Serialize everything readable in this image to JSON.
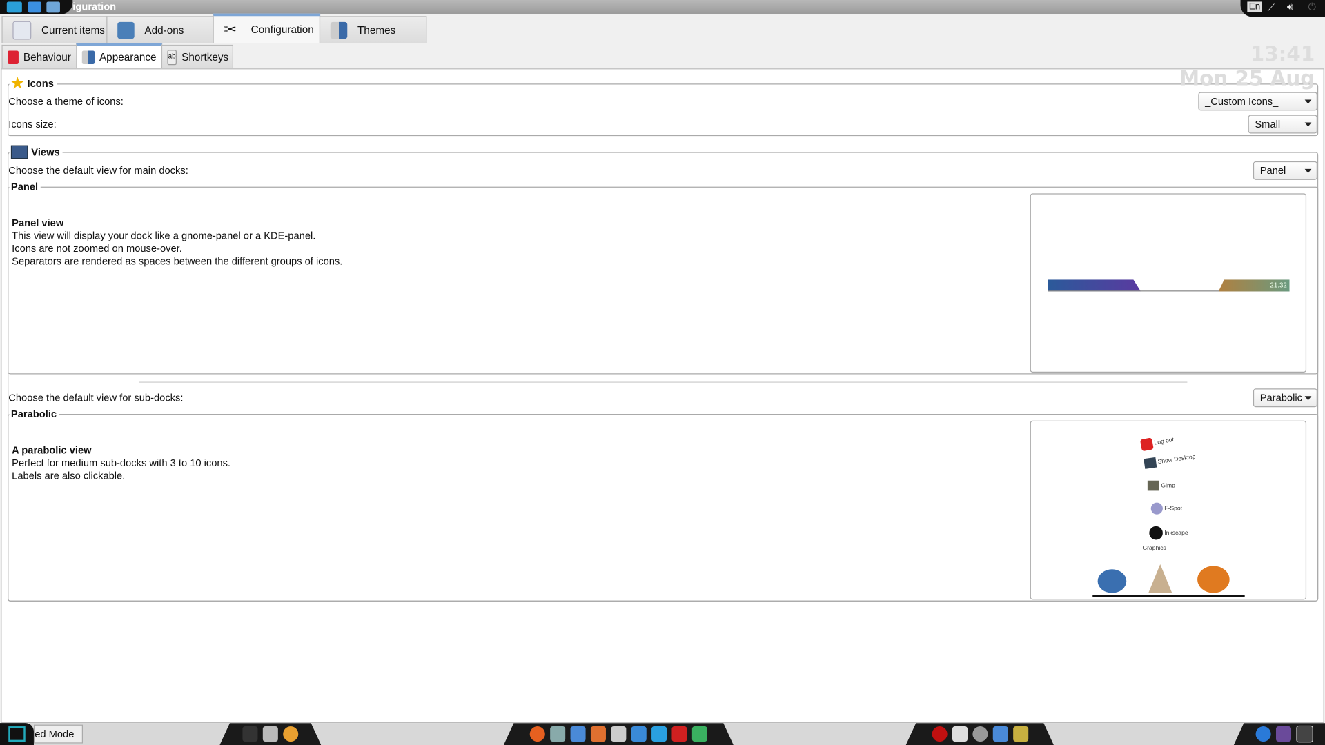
{
  "window": {
    "title": "iguration"
  },
  "tray": {
    "lang": "En",
    "icons": [
      "network-icon",
      "volume-icon",
      "power-icon"
    ]
  },
  "main_tabs": [
    {
      "label": "Current items",
      "icon": "document-icon"
    },
    {
      "label": "Add-ons",
      "icon": "toolbox-icon"
    },
    {
      "label": "Configuration",
      "icon": "tools-icon",
      "active": true
    },
    {
      "label": "Themes",
      "icon": "shirt-icon"
    }
  ],
  "sub_tabs": [
    {
      "label": "Behaviour",
      "icon": "swiss-knife-icon"
    },
    {
      "label": "Appearance",
      "icon": "shirt-icon",
      "active": true
    },
    {
      "label": "Shortkeys",
      "icon": "keys-icon"
    }
  ],
  "clock": {
    "time": "13:41",
    "date": "Mon 25 Aug"
  },
  "icons_group": {
    "title": "Icons",
    "theme_label": "Choose a theme of icons:",
    "theme_value": "_Custom Icons_",
    "size_label": "Icons size:",
    "size_value": "Small"
  },
  "views_group": {
    "title": "Views",
    "main_label": "Choose the default view for main docks:",
    "main_value": "Panel",
    "panel": {
      "title": "Panel",
      "desc_title": "Panel view",
      "desc_lines": [
        "This view will display your dock like a gnome-panel or a KDE-panel.",
        "Icons are not zoomed on mouse-over.",
        "Separators are rendered as spaces between the different groups of icons."
      ],
      "preview_clock": "21:32"
    },
    "sub_label": "Choose the default view for sub-docks:",
    "sub_value": "Parabolic",
    "parabolic": {
      "title": "Parabolic",
      "desc_title": "A parabolic view",
      "desc_lines": [
        "Perfect for medium sub-docks with 3 to 10 icons.",
        "Labels are also clickable."
      ],
      "preview_labels": [
        "Log out",
        "Show Desktop",
        "Gimp",
        "F-Spot",
        "Inkscape",
        "Graphics"
      ]
    }
  },
  "taskbar": {
    "mode_label": "ed Mode"
  },
  "colors": {
    "accent": "#7ea6d6",
    "clock": "#dddddd"
  }
}
